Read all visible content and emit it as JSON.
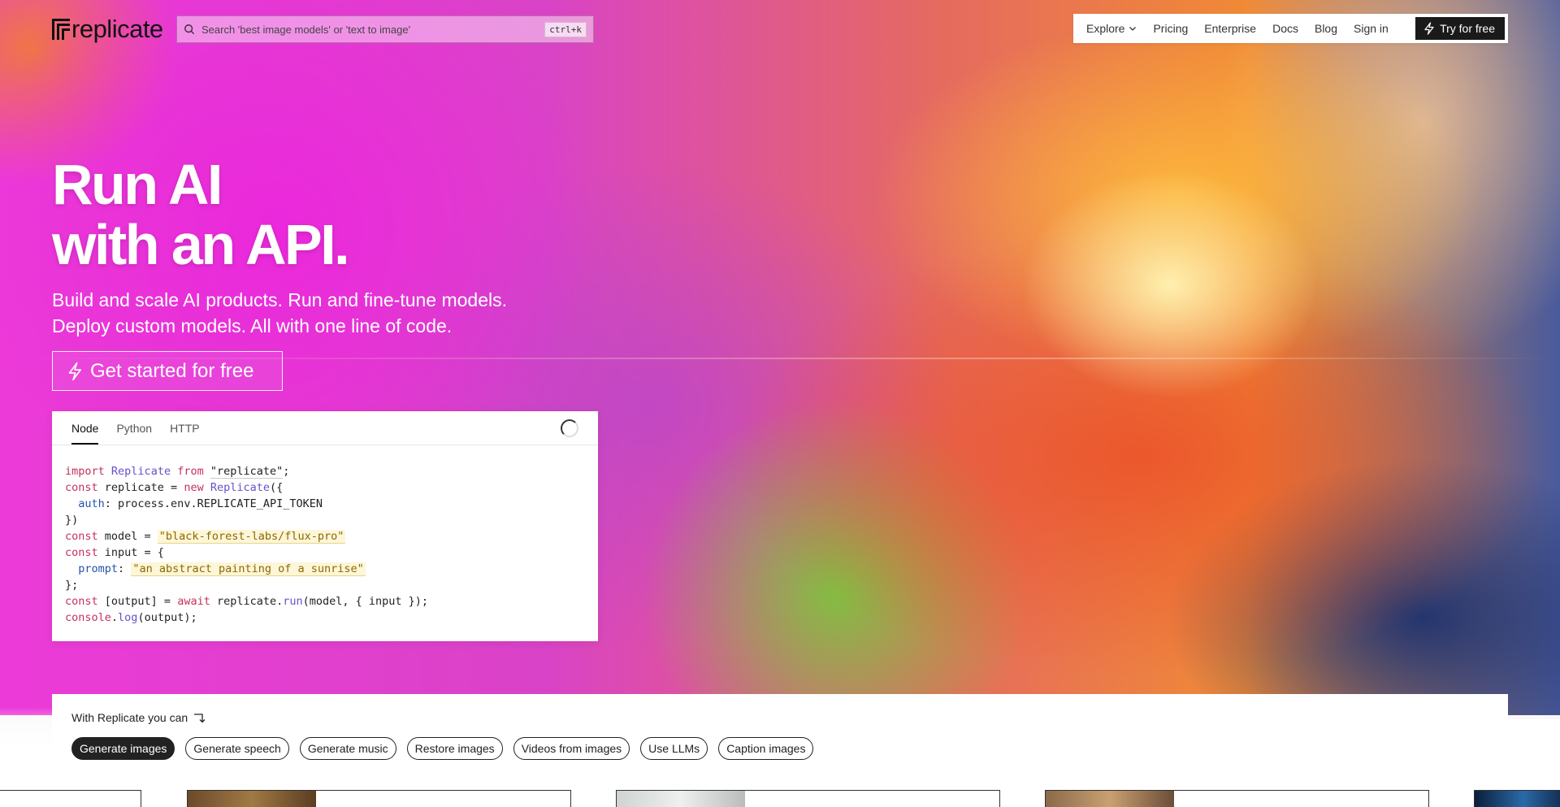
{
  "header": {
    "logo_text": "replicate",
    "search": {
      "placeholder": "Search 'best image models' or 'text to image'",
      "shortcut": "ctrl+k"
    },
    "nav": {
      "explore": "Explore",
      "pricing": "Pricing",
      "enterprise": "Enterprise",
      "docs": "Docs",
      "blog": "Blog",
      "sign_in": "Sign in",
      "try_free": "Try for free"
    }
  },
  "hero": {
    "title_line1": "Run AI",
    "title_line2": "with an API.",
    "subtitle_line1": "Build and scale AI products. Run and fine-tune models.",
    "subtitle_line2": "Deploy custom models. All with one line of code.",
    "cta": "Get started for free"
  },
  "code_panel": {
    "tabs": [
      "Node",
      "Python",
      "HTTP"
    ],
    "active_tab": "Node",
    "lines": {
      "l1_import": "import",
      "l1_cls": "Replicate",
      "l1_from": "from",
      "l1_str": "\"replicate\"",
      "l1_end": ";",
      "l2_const": "const",
      "l2_var": " replicate = ",
      "l2_new": "new",
      "l2_cls": "Replicate",
      "l2_end": "({",
      "l3_prop": "auth",
      "l3_val": ": process.env.REPLICATE_API_TOKEN",
      "l4": "})",
      "l5_const": "const",
      "l5_var": " model = ",
      "l5_str": "\"black-forest-labs/flux-pro\"",
      "l6_const": "const",
      "l6_var": " input = {",
      "l7_prop": "prompt",
      "l7_colon": ": ",
      "l7_str": "\"an abstract painting of a sunrise\"",
      "l8": "};",
      "l9_const": "const",
      "l9_var": " [output] = ",
      "l9_await": "await",
      "l9_obj": " replicate.",
      "l9_fn": "run",
      "l9_args": "(model, { input });",
      "l10_obj": "console",
      "l10_dot": ".",
      "l10_fn": "log",
      "l10_args": "(output);"
    }
  },
  "capabilities": {
    "label": "With Replicate you can",
    "pills": [
      "Generate images",
      "Generate speech",
      "Generate music",
      "Restore images",
      "Videos from images",
      "Use LLMs",
      "Caption images"
    ],
    "active_pill": "Generate images"
  },
  "colors": {
    "primary_dark": "#1a1a1a",
    "hero_magenta": "#ec3ad8",
    "hero_orange": "#f08a35",
    "code_keyword": "#c4315b",
    "code_class": "#6a4fc9",
    "code_string": "#8a6a00"
  },
  "icons": {
    "search": "search-icon",
    "chevron": "chevron-down-icon",
    "bolt": "lightning-bolt-icon",
    "arrow": "arrow-down-right-icon"
  }
}
